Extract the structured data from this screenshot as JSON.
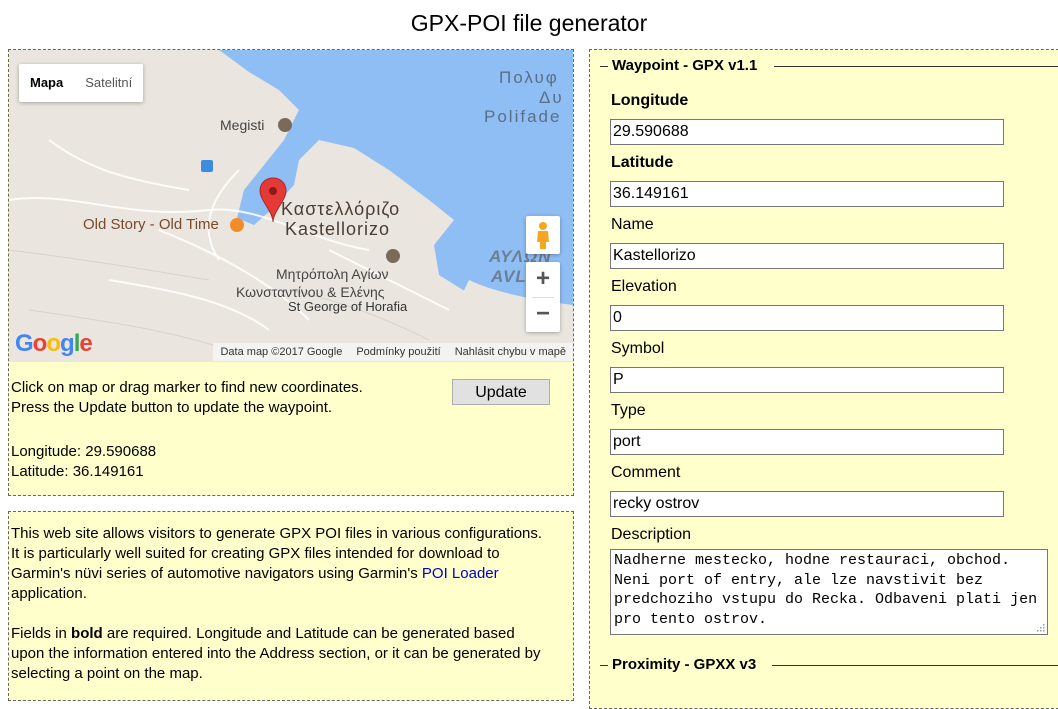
{
  "page_title": "GPX-POI file generator",
  "map": {
    "map_type": [
      "Mapa",
      "Satelitní"
    ],
    "labels": {
      "sea1": "Πολυφ",
      "sea2": "Δυ",
      "sea3": "Polifade",
      "megisti": "Megisti",
      "town_gr": "Καστελλόριζο",
      "town_en": "Kastellorizo",
      "old_story": "Old Story - Old Time",
      "church_gr1": "Μητρόπολη Αγίων",
      "church_gr2": "Κωνσταντίνου & Ελένης",
      "church_en": "St George of Horafia",
      "big1": "ΑΥΛΩΝ",
      "big2": "AVLO"
    },
    "zoom_in": "+",
    "zoom_out": "−",
    "google": "Google",
    "attribution": [
      "Data map ©2017 Google",
      "Podmínky použití",
      "Nahlásit chybu v mapě"
    ]
  },
  "map_panel": {
    "instructions": [
      "Click on map or drag marker to find new coordinates.",
      "Press the Update button to update the waypoint."
    ],
    "update_label": "Update",
    "longitude_text": "Longitude: 29.590688",
    "latitude_text": "Latitude: 36.149161"
  },
  "info": {
    "p1_a": "This web site allows visitors to generate GPX POI files in various configurations. It is particularly well suited for creating GPX files intended for download to Garmin's nüvi series of automotive navigators using Garmin's ",
    "p1_link": "POI Loader",
    "p1_b": " application.",
    "p2_a": "Fields in ",
    "p2_bold": "bold",
    "p2_b": " are required. Longitude and Latitude can be generated based upon the information entered into the Address section, or it can be generated by selecting a point on the map."
  },
  "waypoint": {
    "legend": "Waypoint - GPX v1.1",
    "fields": {
      "longitude": {
        "label": "Longitude",
        "value": "29.590688"
      },
      "latitude": {
        "label": "Latitude",
        "value": "36.149161"
      },
      "name": {
        "label": "Name",
        "value": "Kastellorizo"
      },
      "elevation": {
        "label": "Elevation",
        "value": "0"
      },
      "symbol": {
        "label": "Symbol",
        "value": "P"
      },
      "type": {
        "label": "Type",
        "value": "port"
      },
      "comment": {
        "label": "Comment",
        "value": "recky ostrov"
      },
      "description": {
        "label": "Description",
        "value": "Nadherne mestecko, hodne restauraci, obchod. Neni port of entry, ale lze navstivit bez predchoziho vstupu do Recka. Odbaveni plati jen pro tento ostrov."
      }
    }
  },
  "proximity": {
    "legend": "Proximity - GPXX v3"
  },
  "colors": {
    "panel_bg": "#ffffcc",
    "water": "#8fbef5",
    "land": "#eae6df",
    "marker": "#e53935"
  }
}
